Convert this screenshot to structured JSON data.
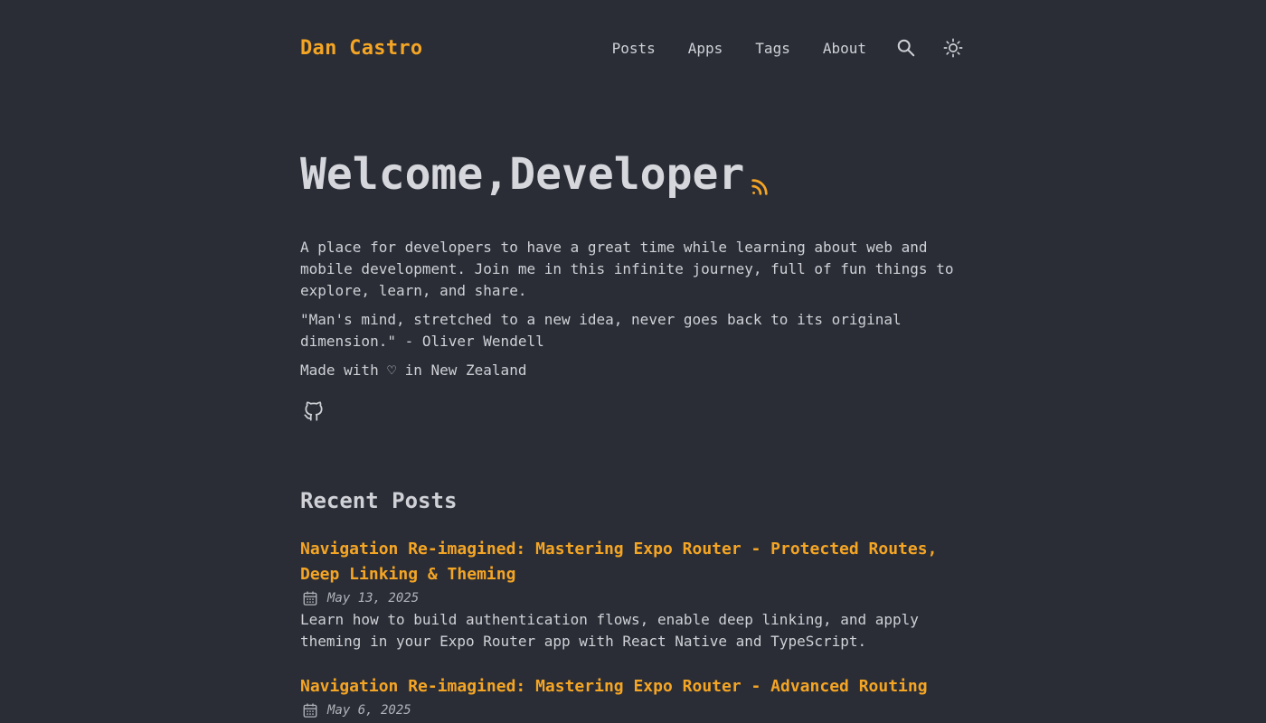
{
  "site": {
    "brand": "Dan Castro",
    "accent_color": "#f5a524",
    "background_color": "#2a2d36"
  },
  "nav": {
    "items": [
      {
        "label": "Posts"
      },
      {
        "label": "Apps"
      },
      {
        "label": "Tags"
      },
      {
        "label": "About"
      }
    ],
    "search_icon": "search-icon",
    "theme_icon": "sun-icon"
  },
  "hero": {
    "title": "Welcome,Developer",
    "rss_icon": "rss-icon",
    "paragraphs": [
      "A place for developers to have a great time while learning about web and mobile development. Join me in this infinite journey, full of fun things to explore, learn, and share.",
      "\"Man's mind, stretched to a new idea, never goes back to its original dimension.\" - Oliver Wendell",
      "Made with ♡ in New Zealand"
    ],
    "github_icon": "github-icon"
  },
  "recent": {
    "heading": "Recent Posts",
    "posts": [
      {
        "title": "Navigation Re-imagined: Mastering Expo Router - Protected Routes, Deep Linking & Theming",
        "date": "May 13, 2025",
        "description": "Learn how to build authentication flows, enable deep linking, and apply theming in your Expo Router app with React Native and TypeScript."
      },
      {
        "title": "Navigation Re-imagined: Mastering Expo Router - Advanced Routing",
        "date": "May 6, 2025",
        "description": ""
      }
    ]
  }
}
